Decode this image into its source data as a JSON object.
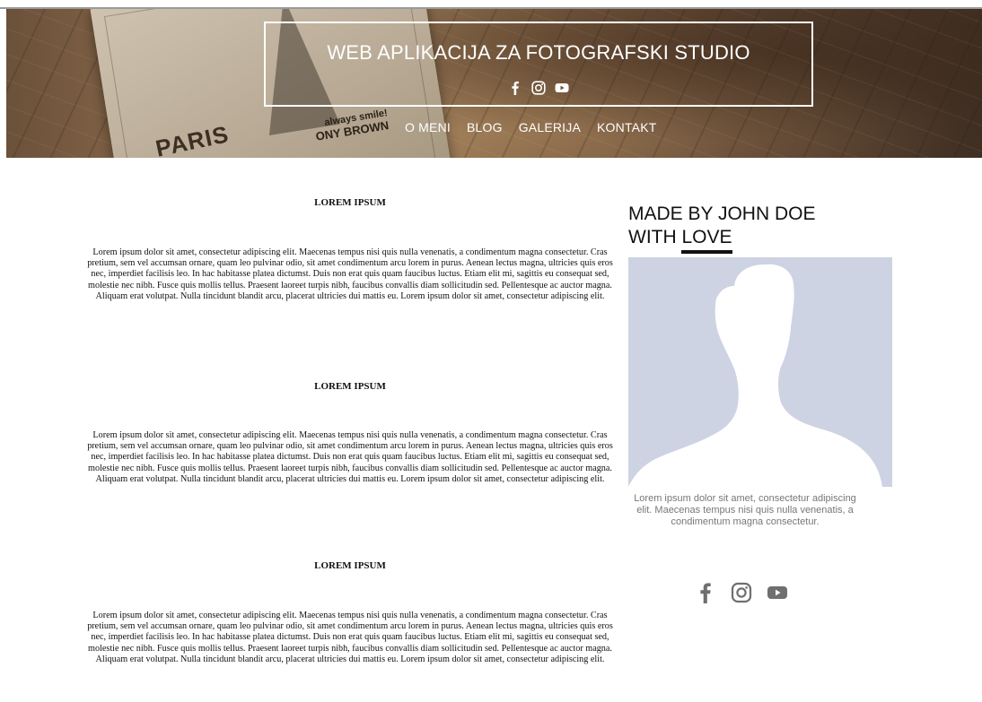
{
  "header": {
    "title": "WEB APLIKACIJA ZA FOTOGRAFSKI STUDIO",
    "postcard": {
      "city": "PARIS",
      "tagline": "always smile!",
      "name": "ONY BROWN"
    },
    "social_icons": [
      "facebook-icon",
      "instagram-icon",
      "youtube-icon"
    ],
    "nav": [
      {
        "label": "O MENI"
      },
      {
        "label": "BLOG"
      },
      {
        "label": "GALERIJA"
      },
      {
        "label": "KONTAKT"
      }
    ]
  },
  "articles": [
    {
      "title": "LOREM IPSUM",
      "body": "Lorem ipsum dolor sit amet, consectetur adipiscing elit. Maecenas tempus nisi quis nulla venenatis, a condimentum magna consectetur. Cras pretium, sem vel accumsan ornare, quam leo pulvinar odio, sit amet condimentum arcu lorem in purus. Aenean lectus magna, ultricies quis eros nec, imperdiet facilisis leo. In hac habitasse platea dictumst. Duis non erat quis quam faucibus luctus. Etiam elit mi, sagittis eu consequat sed, molestie nec nibh. Fusce quis mollis tellus. Praesent laoreet turpis nibh, faucibus convallis diam sollicitudin sed. Pellentesque ac auctor magna. Aliquam erat volutpat. Nulla tincidunt blandit arcu, placerat ultricies dui mattis eu. Lorem ipsum dolor sit amet, consectetur adipiscing elit."
    },
    {
      "title": "LOREM IPSUM",
      "body": "Lorem ipsum dolor sit amet, consectetur adipiscing elit. Maecenas tempus nisi quis nulla venenatis, a condimentum magna consectetur. Cras pretium, sem vel accumsan ornare, quam leo pulvinar odio, sit amet condimentum arcu lorem in purus. Aenean lectus magna, ultricies quis eros nec, imperdiet facilisis leo. In hac habitasse platea dictumst. Duis non erat quis quam faucibus luctus. Etiam elit mi, sagittis eu consequat sed, molestie nec nibh. Fusce quis mollis tellus. Praesent laoreet turpis nibh, faucibus convallis diam sollicitudin sed. Pellentesque ac auctor magna. Aliquam erat volutpat. Nulla tincidunt blandit arcu, placerat ultricies dui mattis eu. Lorem ipsum dolor sit amet, consectetur adipiscing elit."
    },
    {
      "title": "LOREM IPSUM",
      "body": "Lorem ipsum dolor sit amet, consectetur adipiscing elit. Maecenas tempus nisi quis nulla venenatis, a condimentum magna consectetur. Cras pretium, sem vel accumsan ornare, quam leo pulvinar odio, sit amet condimentum arcu lorem in purus. Aenean lectus magna, ultricies quis eros nec, imperdiet facilisis leo. In hac habitasse platea dictumst. Duis non erat quis quam faucibus luctus. Etiam elit mi, sagittis eu consequat sed, molestie nec nibh. Fusce quis mollis tellus. Praesent laoreet turpis nibh, faucibus convallis diam sollicitudin sed. Pellentesque ac auctor magna. Aliquam erat volutpat. Nulla tincidunt blandit arcu, placerat ultricies dui mattis eu. Lorem ipsum dolor sit amet, consectetur adipiscing elit."
    }
  ],
  "sidebar": {
    "heading_line1": "MADE BY JOHN DOE",
    "heading_with": "WITH ",
    "heading_love": "LOVE",
    "avatar_icon": "default-profile-silhouette-icon",
    "text": "Lorem ipsum dolor sit amet, consectetur adipiscing elit. Maecenas tempus nisi quis nulla venenatis, a condimentum magna consectetur.",
    "social_icons": [
      "facebook-icon",
      "instagram-icon",
      "youtube-icon"
    ]
  },
  "colors": {
    "hero_text": "#ffffff",
    "avatar_bg": "#cdd3e2",
    "sidebar_text": "#777777",
    "icon_gray": "#6f6f6f"
  }
}
